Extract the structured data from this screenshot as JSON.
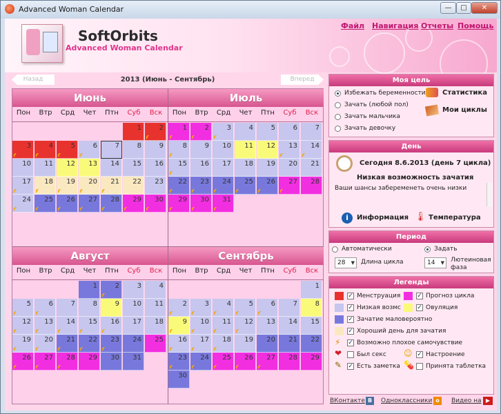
{
  "window": {
    "title": "Advanced Woman Calendar",
    "minimize": "—",
    "maximize": "□",
    "close": "✕"
  },
  "brand": {
    "name": "SoftOrbits",
    "product": "Advanced Woman Calendar"
  },
  "menu": [
    "Файл",
    "Навигация",
    "Отчеты",
    "Помощь"
  ],
  "nav": {
    "prev": "Назад",
    "next": "Вперед",
    "title": "2013 (Июнь - Сентябрь)"
  },
  "weekdays": [
    "Пон",
    "Втр",
    "Срд",
    "Чет",
    "Птн",
    "Суб",
    "Вск"
  ],
  "colors": {
    "m": "#e8322e",
    "f": "#f22ee1",
    "l": "#c6c6ee",
    "o": "#fafa7a",
    "u": "#7878dc",
    "g": "#fae8c0",
    "p": "#f8b8e8",
    "n": "#ffd0ea"
  },
  "months": [
    {
      "name": "Июнь",
      "start": 5,
      "days": 30,
      "types": "lmmmmmlllllloollllggggglluuuufff",
      "marks": [
        2,
        3,
        4,
        5,
        6,
        17,
        18,
        19,
        20,
        21,
        24,
        25,
        26,
        27,
        28,
        29,
        30
      ],
      "today": 7
    },
    {
      "name": "Июль",
      "start": 0,
      "days": 31,
      "types": "ffflllllllloollllllllluuuuuffffff",
      "marks": [
        1,
        2,
        3,
        8,
        13,
        14,
        15,
        22,
        23,
        24,
        25,
        26,
        27,
        29,
        30,
        31
      ]
    },
    {
      "name": "Август",
      "start": 3,
      "days": 31,
      "types": "uuullllllollllllllllluuuufffffuuu",
      "marks": [
        2,
        5,
        6,
        12,
        13,
        14,
        15,
        16,
        19,
        20,
        21,
        22,
        23,
        26,
        27,
        28
      ]
    },
    {
      "name": "Сентябрь",
      "start": 6,
      "days": 30,
      "types": "lllllllloolllllllllluuuuuffffful",
      "marks": [
        2,
        3,
        4,
        5,
        6,
        9,
        10,
        11,
        12,
        16,
        17,
        18,
        23,
        24,
        25,
        26,
        27
      ]
    }
  ],
  "goal": {
    "title": "Моя цель",
    "options": [
      "Избежать беременности",
      "Зачать (любой пол)",
      "Зачать мальчика",
      "Зачать девочку"
    ],
    "selected": 0,
    "stats_label": "Статистика",
    "cycles_label": "Мои циклы"
  },
  "day": {
    "title": "День",
    "today_text": "Сегодня 8.6.2013 (день 7 цикла)",
    "chance_title": "Низкая возможность зачатия",
    "chance_text": "Ваши шансы забеременеть очень низки",
    "info_label": "Информация",
    "temp_label": "Температура"
  },
  "period": {
    "title": "Период",
    "auto_label": "Автоматически",
    "set_label": "Задать",
    "cycle_value": "28",
    "cycle_label": "Длина цикла",
    "luteal_value": "14",
    "luteal_label": "Лютеиновая фаза"
  },
  "legends": {
    "title": "Легенды",
    "items": [
      {
        "label": "Менструация",
        "color": "#e8322e"
      },
      {
        "label": "Прогноз цикла",
        "color": "#f22ee1"
      },
      {
        "label": "Низкая возмс",
        "color": "#c6c6ee"
      },
      {
        "label": "Овуляция",
        "color": "#fafa7a"
      },
      {
        "label": "Зачатие маловероятно",
        "color": "#7878dc"
      },
      {
        "label": "Хороший день для зачатия",
        "color": "#fae8c0"
      },
      {
        "label": "Возможно плохое самочувствие",
        "icon": "lightning-icon"
      },
      {
        "label": "Был секс",
        "icon": "heart-icon"
      },
      {
        "label": "Настроение",
        "icon": "smiley-icon"
      },
      {
        "label": "Есть заметка",
        "icon": "note-icon"
      },
      {
        "label": "Принята таблетка",
        "icon": "pill-icon"
      }
    ]
  },
  "footer": {
    "vk": "ВКонтакте",
    "ok": "Одноклассники",
    "video": "Видео на"
  }
}
